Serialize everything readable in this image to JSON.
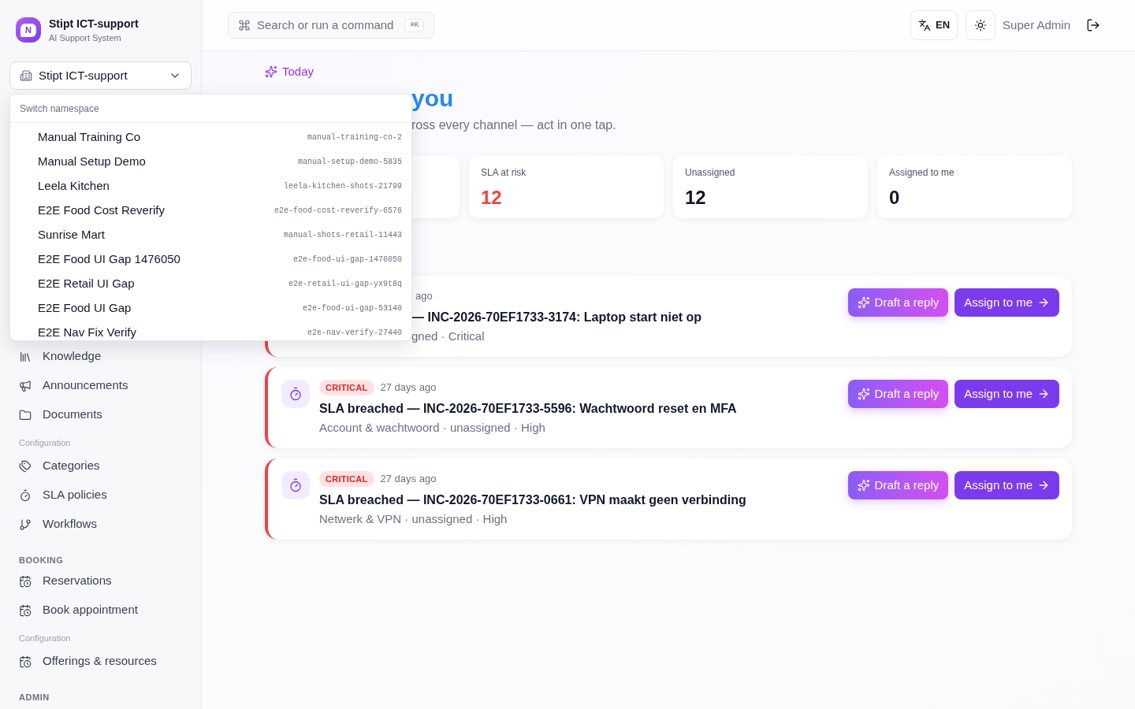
{
  "brand": {
    "logo_letter": "N",
    "title": "Stipt ICT-support",
    "subtitle": "AI Support System"
  },
  "namespace_select": {
    "value": "Stipt ICT-support",
    "expanded": true
  },
  "namespace_menu": {
    "header": "Switch namespace",
    "items": [
      {
        "name": "Manual Training Co",
        "slug": "manual-training-co-2"
      },
      {
        "name": "Manual Setup Demo",
        "slug": "manual-setup-demo-5835"
      },
      {
        "name": "Leela Kitchen",
        "slug": "leela-kitchen-shots-21799"
      },
      {
        "name": "E2E Food Cost Reverify",
        "slug": "e2e-food-cost-reverify-6576"
      },
      {
        "name": "Sunrise Mart",
        "slug": "manual-shots-retail-11443"
      },
      {
        "name": "E2E Food UI Gap 1476050",
        "slug": "e2e-food-ui-gap-1476050"
      },
      {
        "name": "E2E Retail UI Gap",
        "slug": "e2e-retail-ui-gap-yx9t8q"
      },
      {
        "name": "E2E Food UI Gap",
        "slug": "e2e-food-ui-gap-53140"
      },
      {
        "name": "E2E Nav Fix Verify",
        "slug": "e2e-nav-verify-27440"
      }
    ]
  },
  "sidebar": {
    "items": [
      {
        "kind": "link",
        "label": "Knowledge"
      },
      {
        "kind": "link",
        "label": "Announcements"
      },
      {
        "kind": "link",
        "label": "Documents"
      },
      {
        "kind": "subsection",
        "label": "Configuration"
      },
      {
        "kind": "link",
        "label": "Categories"
      },
      {
        "kind": "link",
        "label": "SLA policies"
      },
      {
        "kind": "link",
        "label": "Workflows"
      },
      {
        "kind": "section",
        "label": "BOOKING"
      },
      {
        "kind": "link",
        "label": "Reservations"
      },
      {
        "kind": "link",
        "label": "Book appointment"
      },
      {
        "kind": "subsection",
        "label": "Configuration"
      },
      {
        "kind": "link",
        "label": "Offerings & resources"
      },
      {
        "kind": "section",
        "label": "ADMIN"
      }
    ]
  },
  "topbar": {
    "search": {
      "label": "Search or run a command",
      "shortcut": "⌘K"
    },
    "language": "EN",
    "user": "Super Admin"
  },
  "hero": {
    "eyebrow": "Today",
    "heading": "you",
    "subtitle": "ross every channel — act in one tap."
  },
  "stats": [
    {
      "kind": "covered"
    },
    {
      "kind": "metric",
      "label": "SLA at risk",
      "value": "12",
      "alert": true
    },
    {
      "kind": "metric",
      "label": "Unassigned",
      "value": "12",
      "alert": false
    },
    {
      "kind": "metric",
      "label": "Assigned to me",
      "value": "0",
      "alert": false
    }
  ],
  "incidents": [
    {
      "kind": "covered",
      "age": "ago",
      "title": "— INC-2026-70EF1733-3174: Laptop start niet op",
      "meta": "gned · Critical",
      "actions": [
        {
          "kind": "ai",
          "label": "Draft a reply"
        },
        {
          "kind": "primary",
          "label": "Assign to me"
        }
      ]
    },
    {
      "kind": "full",
      "severity": "CRITICAL",
      "age": "27 days ago",
      "title": "SLA breached — INC-2026-70EF1733-5596: Wachtwoord reset en MFA",
      "meta": "Account & wachtwoord · unassigned · High",
      "actions": [
        {
          "kind": "ai",
          "label": "Draft a reply"
        },
        {
          "kind": "primary",
          "label": "Assign to me"
        }
      ]
    },
    {
      "kind": "full",
      "severity": "CRITICAL",
      "age": "27 days ago",
      "title": "SLA breached — INC-2026-70EF1733-0661: VPN maakt geen verbinding",
      "meta": "Netwerk & VPN · unassigned · High",
      "actions": [
        {
          "kind": "ai",
          "label": "Draft a reply"
        },
        {
          "kind": "primary",
          "label": "Assign to me"
        }
      ]
    }
  ]
}
